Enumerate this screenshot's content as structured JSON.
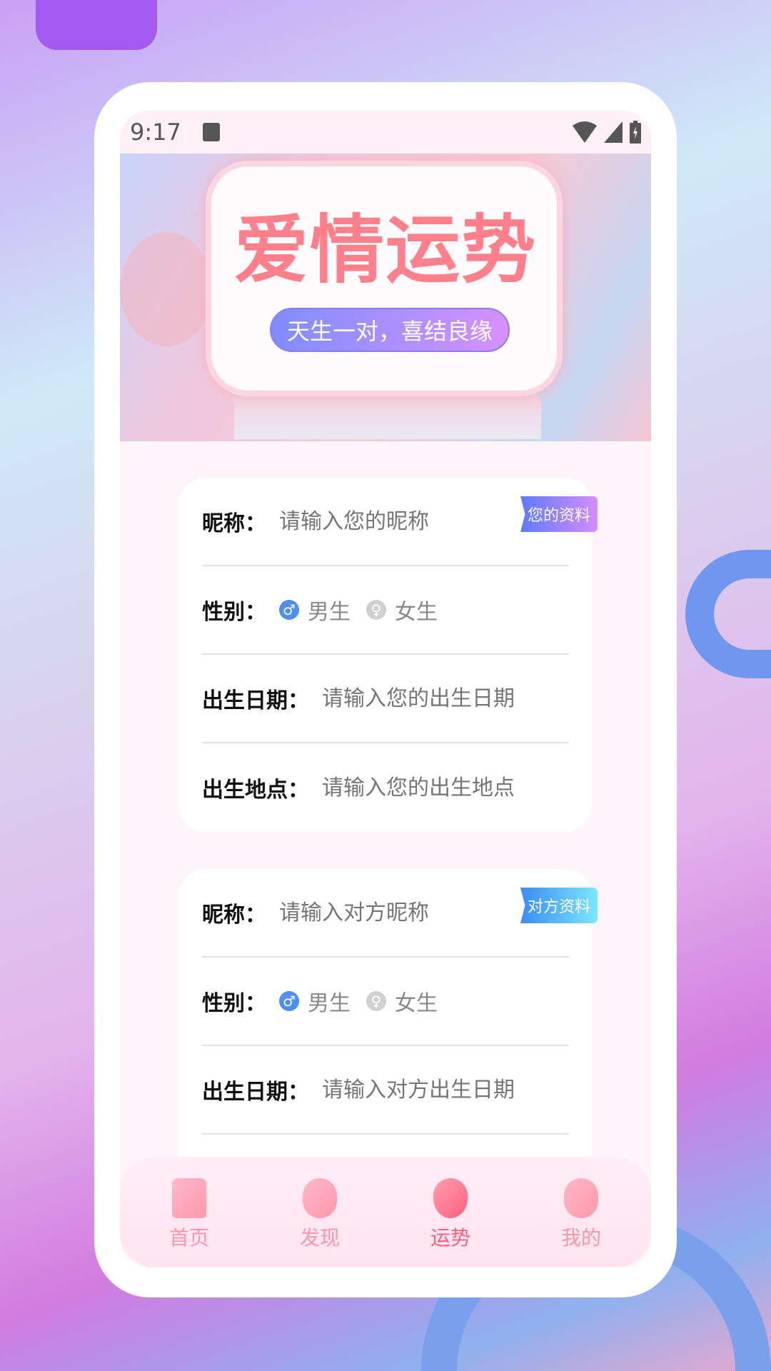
{
  "status": {
    "time": "9:17"
  },
  "banner": {
    "title": "爱情运势",
    "slogan": "天生一对，喜结良缘"
  },
  "my_card": {
    "tag": "您的资料",
    "nickname_label": "昵称：",
    "nickname_placeholder": "请输入您的昵称",
    "gender_label": "性别：",
    "male": "男生",
    "female": "女生",
    "birthdate_label": "出生日期：",
    "birthdate_placeholder": "请输入您的出生日期",
    "birthplace_label": "出生地点：",
    "birthplace_placeholder": "请输入您的出生地点"
  },
  "partner_card": {
    "tag": "对方资料",
    "nickname_label": "昵称：",
    "nickname_placeholder": "请输入对方昵称",
    "gender_label": "性别：",
    "male": "男生",
    "female": "女生",
    "birthdate_label": "出生日期：",
    "birthdate_placeholder": "请输入对方出生日期"
  },
  "tabs": [
    {
      "label": "首页",
      "icon": "home-icon"
    },
    {
      "label": "发现",
      "icon": "compass-icon"
    },
    {
      "label": "运势",
      "icon": "heart-icon",
      "active": true
    },
    {
      "label": "我的",
      "icon": "profile-icon"
    }
  ],
  "colors": {
    "accent": "#ff7f8a",
    "tab_active": "#ff5e7c",
    "male": "#4d8ff5",
    "my_tag": "#6b7dff",
    "partner_tag": "#3aaaf5"
  }
}
